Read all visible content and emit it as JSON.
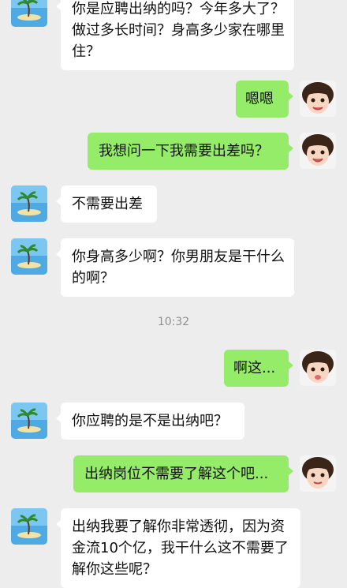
{
  "chat": {
    "timestamp": "10:32",
    "messages": [
      {
        "side": "in",
        "text": "你是应聘出纳的吗？今年多大了？做过多长时间？身高多少家在哪里住？"
      },
      {
        "side": "out",
        "text": "嗯嗯"
      },
      {
        "side": "out",
        "text": "我想问一下我需要出差吗？"
      },
      {
        "side": "in",
        "text": "不需要出差"
      },
      {
        "side": "in",
        "text": "你身高多少啊？你男朋友是干什么的啊？"
      },
      {
        "side": "out",
        "text": "啊这..."
      },
      {
        "side": "in",
        "text": "你应聘的是不是出纳吧？"
      },
      {
        "side": "out",
        "text": "出纳岗位不需要了解这个吧..."
      },
      {
        "side": "in",
        "text": "出纳我要了解你非常透彻，因为资金流10个亿，我干什么这不需要了解你这些呢？"
      }
    ]
  },
  "colors": {
    "background": "#ededed",
    "bubble_in": "#ffffff",
    "bubble_out": "#95ec69"
  },
  "icons": {
    "sender_avatar": "island-avatar-icon",
    "self_avatar": "child-avatar-icon"
  }
}
